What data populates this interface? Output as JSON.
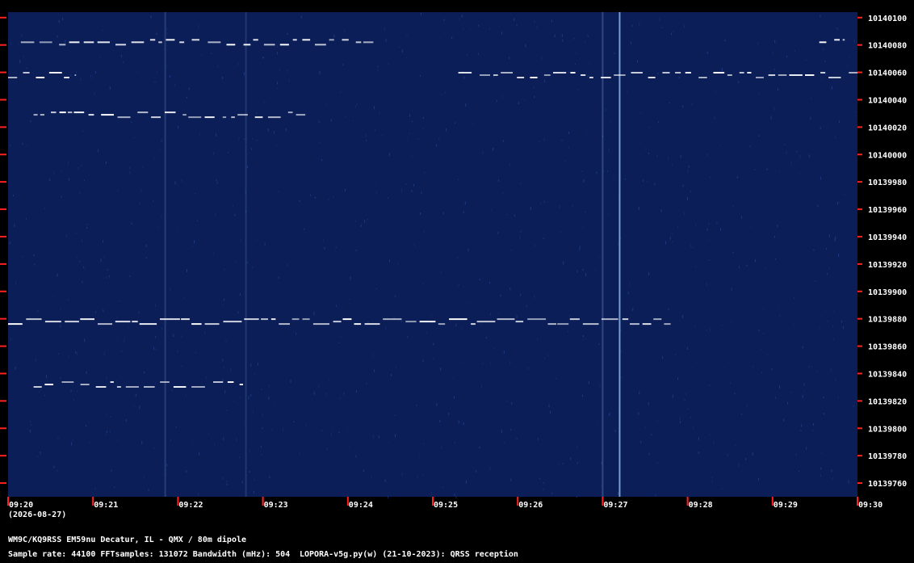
{
  "chart_data": {
    "type": "heatmap",
    "title": "",
    "xlabel": "",
    "ylabel": "",
    "x_ticks": [
      "09:20",
      "09:21",
      "09:22",
      "09:23",
      "09:24",
      "09:25",
      "09:26",
      "09:27",
      "09:28",
      "09:29",
      "09:30"
    ],
    "x_range_minutes": [
      0,
      10
    ],
    "y_ticks": [
      10140100,
      10140080,
      10140060,
      10140040,
      10140020,
      10140000,
      10139980,
      10139960,
      10139940,
      10139920,
      10139900,
      10139880,
      10139860,
      10139840,
      10139820,
      10139800,
      10139780,
      10139760
    ],
    "ylim": [
      10139750,
      10140104
    ],
    "date_label": "(2026-08-27)",
    "colors": {
      "background": "#0b1e58",
      "signal": "#ffffff",
      "ticks": "#ff2020"
    },
    "signals": [
      {
        "freq": 10140082,
        "start": 0.15,
        "end": 4.3,
        "pattern": "qrss"
      },
      {
        "freq": 10140082,
        "start": 9.55,
        "end": 9.85,
        "pattern": "qrss"
      },
      {
        "freq": 10140058,
        "start": 0.0,
        "end": 0.8,
        "pattern": "qrss"
      },
      {
        "freq": 10140058,
        "start": 5.3,
        "end": 10.0,
        "pattern": "qrss"
      },
      {
        "freq": 10140029,
        "start": 0.3,
        "end": 3.5,
        "pattern": "qrss"
      },
      {
        "freq": 10139878,
        "start": 0.0,
        "end": 7.8,
        "pattern": "fsk"
      },
      {
        "freq": 10139832,
        "start": 0.3,
        "end": 2.8,
        "pattern": "qrss"
      }
    ],
    "vertical_lines": [
      {
        "time": 7.2,
        "strength": 0.75
      },
      {
        "time": 7.0,
        "strength": 0.25
      },
      {
        "time": 1.85,
        "strength": 0.18
      },
      {
        "time": 2.8,
        "strength": 0.15
      }
    ]
  },
  "footer": {
    "station": "WM9C/KQ9RSS EM59nu Decatur, IL - QMX / 80m dipole",
    "params": "Sample rate: 44100    FFTsamples: 131072    Bandwidth (mHz): 504",
    "software": "LOPORA-v5g.py(w) (21-10-2023): QRSS reception"
  }
}
